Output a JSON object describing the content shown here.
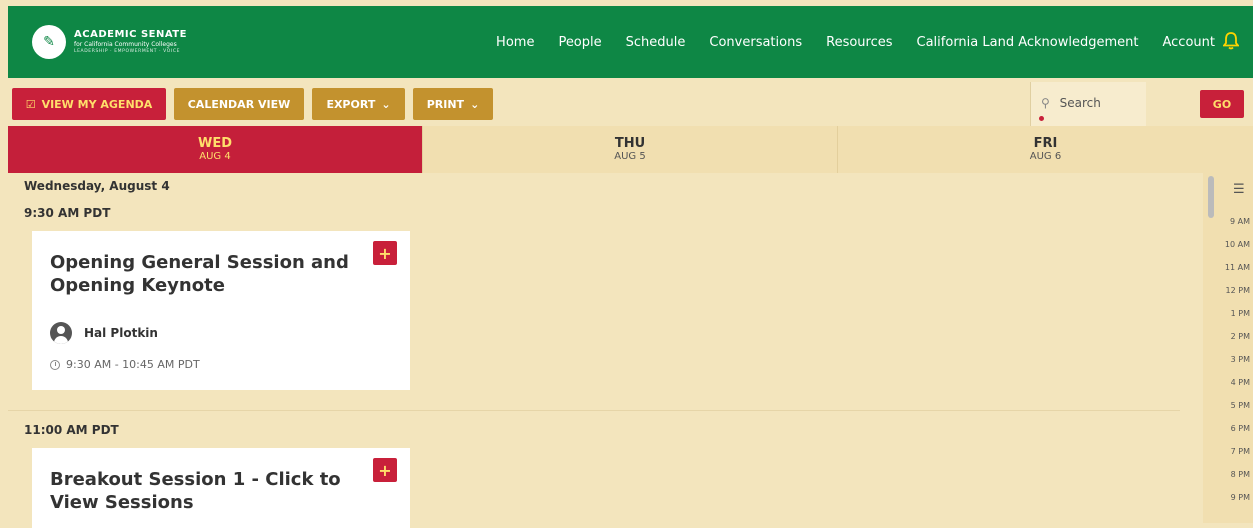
{
  "header": {
    "logo_title": "ACADEMIC SENATE",
    "logo_subtitle": "for California Community Colleges",
    "logo_tagline": "LEADERSHIP · EMPOWERMENT · VOICE",
    "nav": [
      "Home",
      "People",
      "Schedule",
      "Conversations",
      "Resources",
      "California Land Acknowledgement",
      "Account"
    ],
    "icons": {
      "bell": "bell-icon",
      "logo": "academic-senate-logo"
    }
  },
  "toolbar": {
    "view_my_agenda": "VIEW MY AGENDA",
    "calendar_view": "CALENDAR VIEW",
    "export": "EXPORT",
    "print": "PRINT",
    "search_placeholder": "Search",
    "go": "GO"
  },
  "days": [
    {
      "name": "WED",
      "date": "AUG 4",
      "active": true
    },
    {
      "name": "THU",
      "date": "AUG 5",
      "active": false
    },
    {
      "name": "FRI",
      "date": "AUG 6",
      "active": false
    }
  ],
  "schedule": {
    "date_heading": "Wednesday, August 4",
    "slots": [
      {
        "time": "9:30 AM PDT",
        "title": "Opening General Session and Opening Keynote",
        "speaker": "Hal Plotkin",
        "range": "9:30 AM - 10:45 AM PDT"
      },
      {
        "time": "11:00 AM PDT",
        "title": "Breakout Session 1 - Click to View Sessions"
      }
    ]
  },
  "time_rail": [
    "9 AM",
    "10 AM",
    "11 AM",
    "12 PM",
    "1 PM",
    "2 PM",
    "3 PM",
    "4 PM",
    "5 PM",
    "6 PM",
    "7 PM",
    "8 PM",
    "9 PM"
  ],
  "colors": {
    "green": "#0e8745",
    "red": "#c8203a",
    "gold": "#c3922e",
    "cream": "#f3e5bd",
    "yellow": "#ffdf6b"
  }
}
